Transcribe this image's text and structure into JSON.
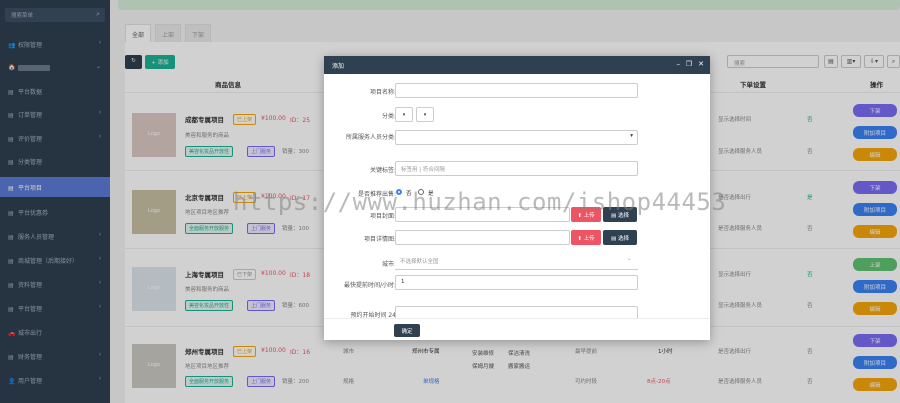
{
  "sidebar": {
    "search_placeholder": "搜索菜单",
    "items": [
      {
        "icon": "👥",
        "label": "权限管理"
      },
      {
        "icon": "🏠",
        "label": ""
      },
      {
        "icon": "▤",
        "label": "平台数据"
      },
      {
        "icon": "▤",
        "label": "订单管理"
      },
      {
        "icon": "▤",
        "label": "评价管理"
      },
      {
        "icon": "▤",
        "label": "分类管理"
      },
      {
        "icon": "▤",
        "label": "平台项目"
      },
      {
        "icon": "▤",
        "label": "平台优惠券"
      },
      {
        "icon": "▤",
        "label": "服务人员管理"
      },
      {
        "icon": "▤",
        "label": "商城管理（后期接好）"
      },
      {
        "icon": "▤",
        "label": "资料管理"
      },
      {
        "icon": "▤",
        "label": "平台管理"
      },
      {
        "icon": "🚗",
        "label": "城市出行"
      },
      {
        "icon": "▤",
        "label": "财务管理"
      },
      {
        "icon": "👤",
        "label": "用户管理"
      }
    ]
  },
  "tabs": [
    "全部",
    "上架",
    "下架"
  ],
  "toolbar": {
    "add_label": "添加",
    "search_placeholder": "搜索"
  },
  "table": {
    "headers": [
      "商品信息",
      "下单设置",
      "操作"
    ],
    "rows": [
      {
        "name": "成都专属项目",
        "status": "已上架",
        "price": "¥100.00",
        "id": "ID：25",
        "desc": "美容和服务的商品",
        "tag1": "美容化妆品开放性",
        "tag2": "上门服务",
        "sales": "销量：300",
        "order1": "显示选择时间",
        "order2": "显示选择服务人员",
        "v1": "否",
        "v2": "否",
        "ops": [
          "下架",
          "附加项目",
          "编辑"
        ],
        "thumb": "#dcc9c2"
      },
      {
        "name": "北京专属项目",
        "status": "已上架",
        "price": "¥100.00",
        "id": "ID：17",
        "desc": "地区项目地区推荐",
        "tag1": "全面服务开放服务",
        "tag2": "上门服务",
        "sales": "销量：100",
        "order1": "是否选择出行",
        "order2": "是否选择服务人员",
        "v1": "是",
        "v2": "否",
        "ops": [
          "下架",
          "附加项目",
          "编辑"
        ],
        "thumb": "#c6c0a2"
      },
      {
        "name": "上海专属项目",
        "status": "已下架",
        "price": "¥100.00",
        "id": "ID：18",
        "desc": "美容和服务的商品",
        "tag1": "美容化妆品开放性",
        "tag2": "上门服务",
        "sales": "销量：600",
        "order1": "显示选择出行",
        "order2": "显示选择服务人员",
        "v1": "否",
        "v2": "否",
        "ops": [
          "上架",
          "附加项目",
          "编辑"
        ],
        "thumb": "#dce4ec"
      },
      {
        "name": "郑州专属项目",
        "status": "已上架",
        "price": "¥100.00",
        "id": "ID：16",
        "desc": "地区项目地区推荐",
        "tag1": "全面服务开放服务",
        "tag2": "上门服务",
        "sales": "销量：200",
        "order1": "是否选择出行",
        "order2": "是否选择服务人员",
        "v1": "否",
        "v2": "否",
        "ops": [
          "下架",
          "附加项目",
          "编辑"
        ],
        "thumb": "#cbc9c2",
        "extra": {
          "city_label": "城市",
          "city": "郑州市专属",
          "svc1": "安装维修",
          "svc2": "保洁清洗",
          "svc3": "保姆月嫂",
          "svc4": "搬家搬运",
          "min_label": "最早提前",
          "min_val": "1小时",
          "spec_label": "规格",
          "spec_val": "单规格",
          "time_label": "可约时段",
          "time_val": "8点-20点"
        }
      }
    ]
  },
  "modal": {
    "title": "添加",
    "fields": {
      "name_label": "项目名称:",
      "cat_label": "分类:",
      "staff_label": "所属服务人员分类:",
      "tag_label": "关键标签:",
      "tag_placeholder": "标签用 | 符合间隔",
      "time_label": "是否推荐出售:",
      "opt_no": "否",
      "opt_yes": "是",
      "img_label": "项目封面:",
      "detail_label": "项目详情图:",
      "upload_label": "上传",
      "select_label": "选择",
      "city_label": "城市:",
      "city_placeholder": "不选择默认全国",
      "min_label": "最快提前时间/小时:",
      "min_value": "1",
      "start_label": "预约开始时间 24"
    },
    "submit_label": "确定"
  },
  "watermark": "https://www.huzhan.com/ishop44453"
}
